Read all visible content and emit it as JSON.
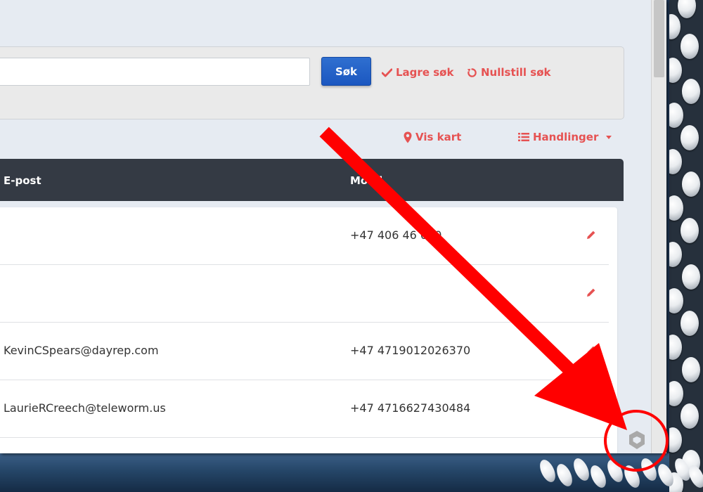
{
  "search": {
    "input_value": "",
    "button_label": "Søk",
    "save_label": "Lagre søk",
    "reset_label": "Nullstill søk"
  },
  "toolbar": {
    "map_label": "Vis kart",
    "actions_label": "Handlinger"
  },
  "table": {
    "columns": [
      "E-post",
      "Mobil"
    ],
    "rows": [
      {
        "email": "",
        "mobile": "+47 406 46 000"
      },
      {
        "email": "",
        "mobile": ""
      },
      {
        "email": "KevinCSpears@dayrep.com",
        "mobile": "+47 4719012026370"
      },
      {
        "email": "LaurieRCreech@teleworm.us",
        "mobile": "+47 4716627430484"
      }
    ]
  },
  "colors": {
    "accent": "#e65252",
    "primary_button": "#1b57c0",
    "header_bg": "#343a44",
    "annotation": "#ff0000"
  },
  "icons": {
    "save": "check-icon",
    "reset": "refresh-icon",
    "map": "map-marker-icon",
    "actions": "list-icon",
    "edit": "pencil-icon",
    "widget": "shield-icon"
  }
}
